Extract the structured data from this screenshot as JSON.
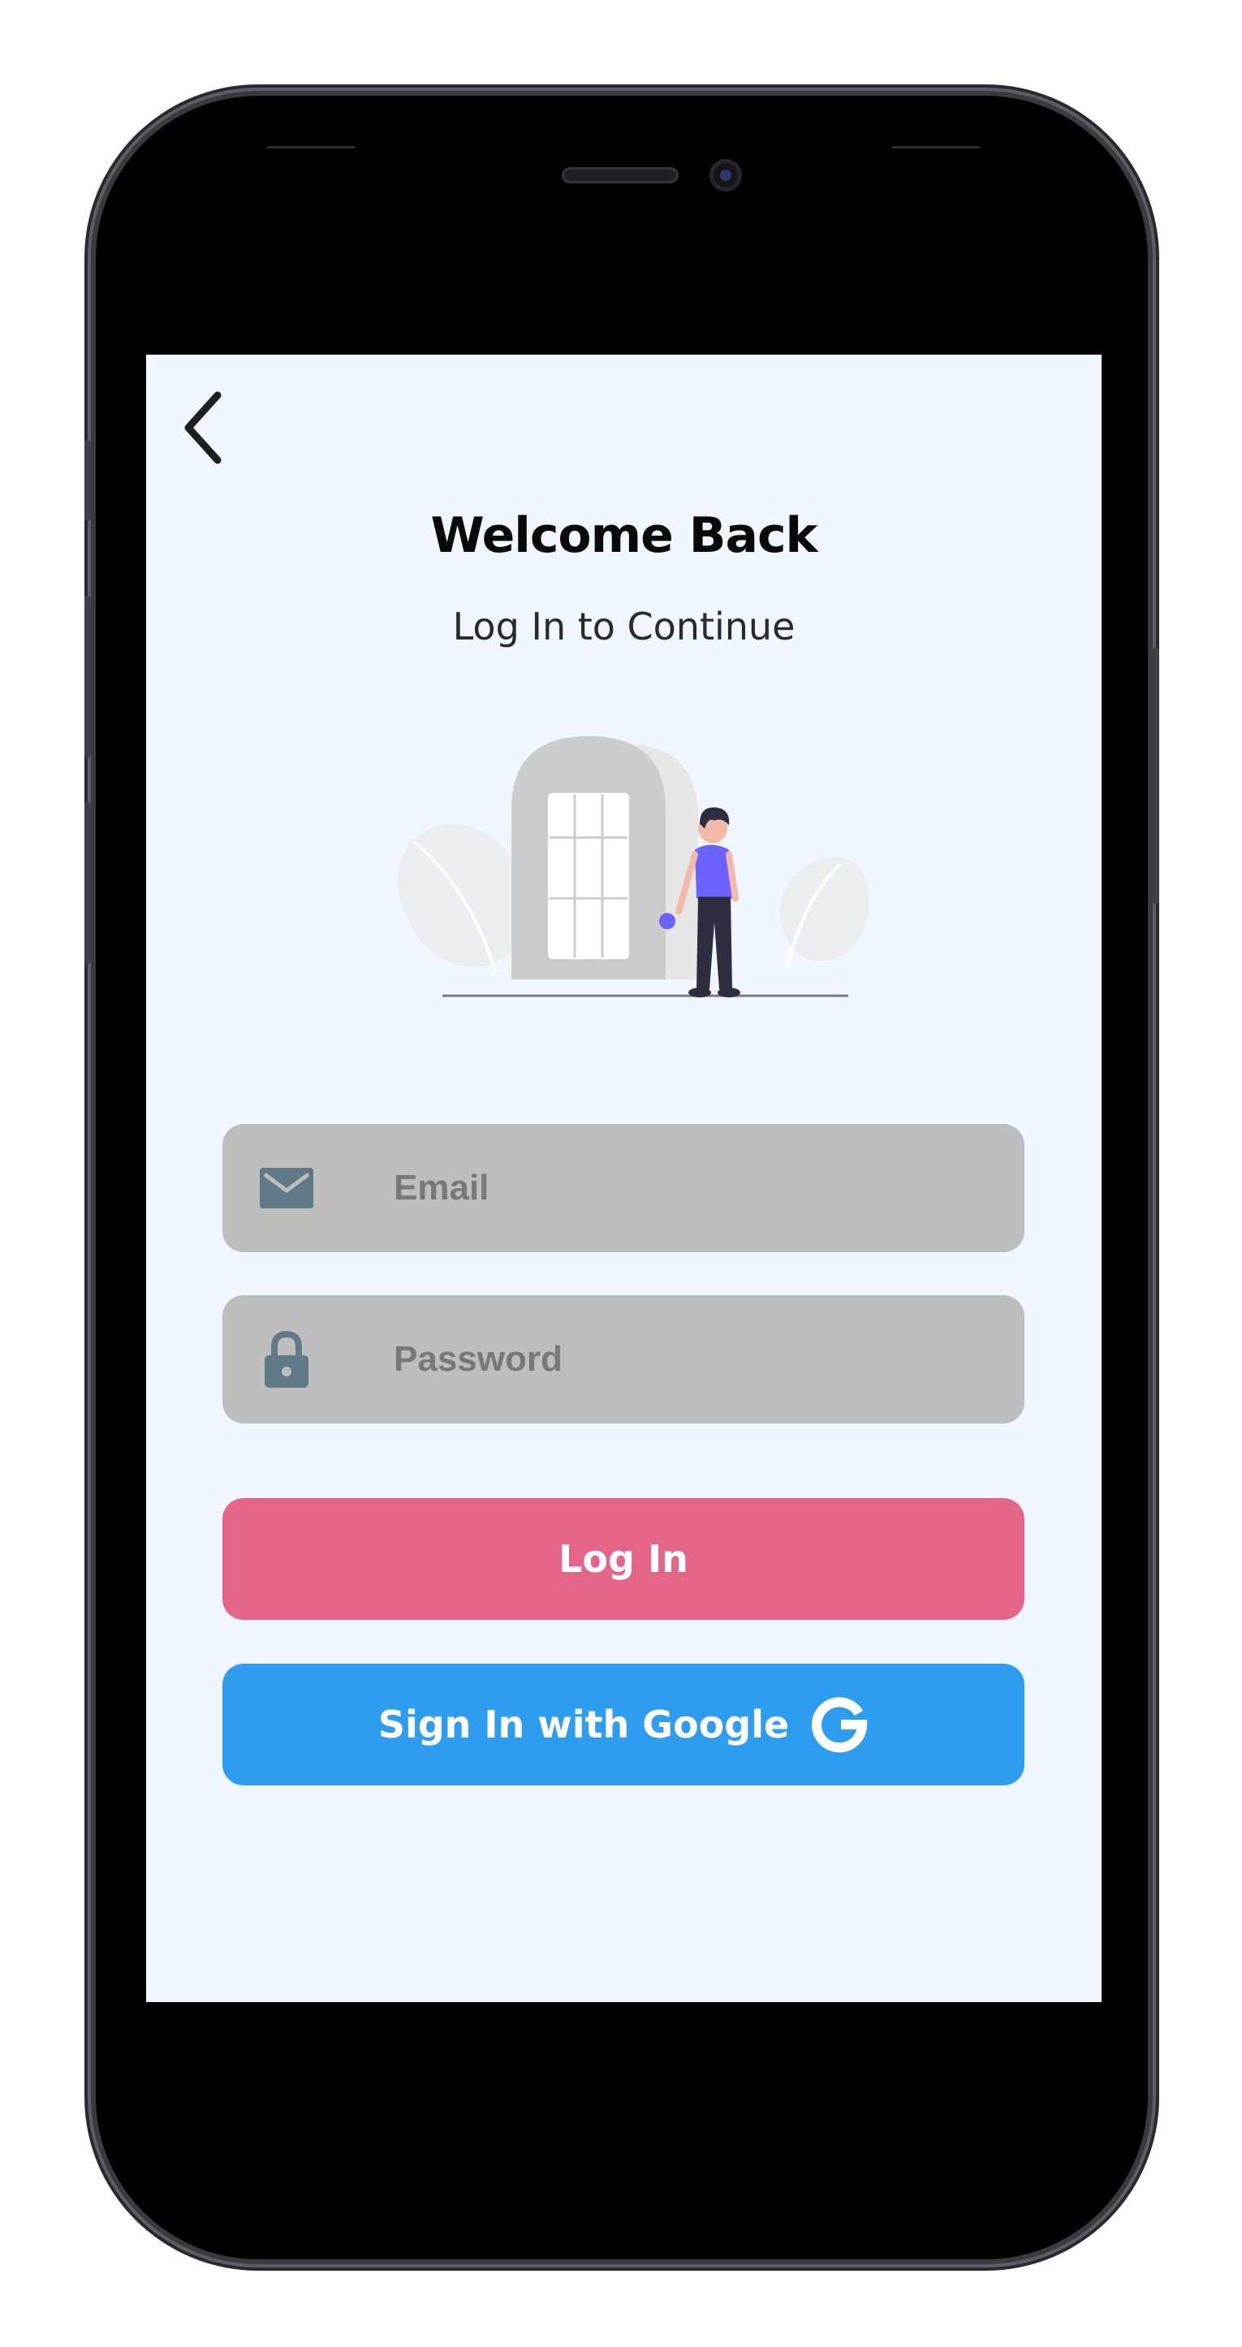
{
  "screen": {
    "title": "Welcome Back",
    "subtitle": "Log In to Continue"
  },
  "form": {
    "email_placeholder": "Email",
    "password_placeholder": "Password"
  },
  "actions": {
    "login_label": "Log In",
    "google_label": "Sign In with Google"
  },
  "colors": {
    "background": "#f1f5fd",
    "field_fill": "#bdbdbd",
    "login_button": "#e46588",
    "google_button": "#2f9def",
    "icon_color": "#5f7a86",
    "accent_person": "#6c63ff"
  },
  "icons": {
    "back": "chevron-left-icon",
    "email": "envelope-icon",
    "password": "lock-icon",
    "google": "google-g-icon"
  }
}
